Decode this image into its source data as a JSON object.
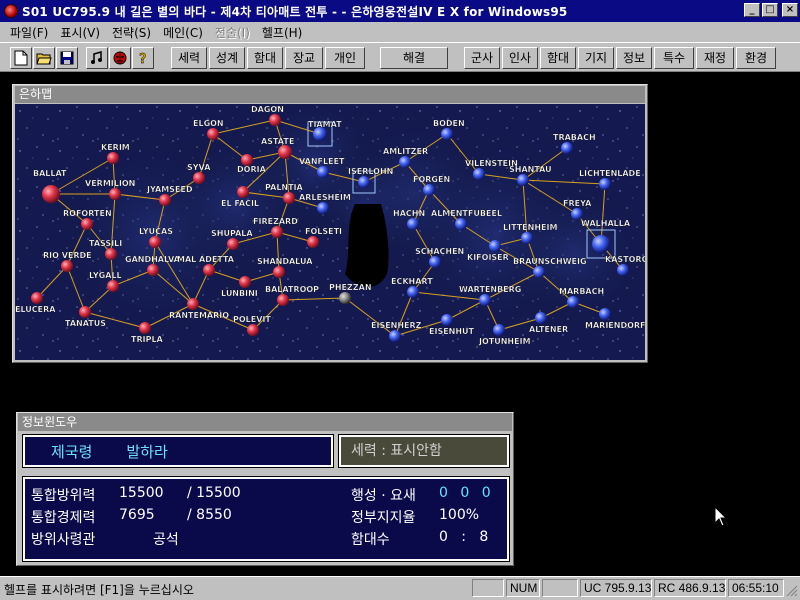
{
  "window": {
    "title": "S01 UC795.9  내 길은 별의 바다    - 제4차 티아매트 전투 - - 은하영웅전설IV  E X for Windows95",
    "min_label": "_",
    "max_label": "□",
    "close_label": "×"
  },
  "menu": [
    {
      "label": "파일(F)",
      "enabled": true
    },
    {
      "label": "표시(V)",
      "enabled": true
    },
    {
      "label": "전략(S)",
      "enabled": true
    },
    {
      "label": "메인(C)",
      "enabled": true
    },
    {
      "label": "전술(I)",
      "enabled": false
    },
    {
      "label": "헬프(H)",
      "enabled": true
    }
  ],
  "toolbar": {
    "icons": [
      "new-file-icon",
      "open-folder-icon",
      "save-disk-icon",
      "music-note-icon",
      "ladybug-icon",
      "help-question-icon"
    ],
    "groups": [
      [
        "세력",
        "성계",
        "함대",
        "장교",
        "개인"
      ],
      [
        "해결"
      ],
      [
        "군사",
        "인사",
        "함대",
        "기지",
        "정보",
        "특수",
        "재정",
        "환경"
      ]
    ]
  },
  "galaxy_map": {
    "caption": "은하맵",
    "empire_color": "#d8304a",
    "alliance_color": "#3c58e8",
    "neutral_color": "#8a8a8a",
    "link_color": "#d8a020",
    "systems": [
      {
        "name": "TIAMAT",
        "side": "alliance",
        "highlight": true
      },
      {
        "name": "DAGON",
        "side": "empire"
      },
      {
        "name": "ELGON",
        "side": "empire"
      },
      {
        "name": "KERIM",
        "side": "empire"
      },
      {
        "name": "ASTATE",
        "side": "empire"
      },
      {
        "name": "DORIA",
        "side": "empire"
      },
      {
        "name": "SYVA",
        "side": "empire"
      },
      {
        "name": "VANFLEET",
        "side": "alliance"
      },
      {
        "name": "ISERLOHN",
        "side": "alliance",
        "highlight": true
      },
      {
        "name": "BALLAT",
        "side": "empire"
      },
      {
        "name": "VERMILION",
        "side": "empire"
      },
      {
        "name": "JYAMSEED",
        "side": "empire"
      },
      {
        "name": "EL FACIL",
        "side": "empire"
      },
      {
        "name": "PALNTIA",
        "side": "empire"
      },
      {
        "name": "ARLESHEIM",
        "side": "alliance"
      },
      {
        "name": "ROFORTEN",
        "side": "empire"
      },
      {
        "name": "FIREZARD",
        "side": "empire"
      },
      {
        "name": "LYUCAS",
        "side": "empire"
      },
      {
        "name": "SHUPALA",
        "side": "empire"
      },
      {
        "name": "FOLSETI",
        "side": "empire"
      },
      {
        "name": "TASSILI",
        "side": "empire"
      },
      {
        "name": "RIO VERDE",
        "side": "empire"
      },
      {
        "name": "GANDHALVA",
        "side": "empire"
      },
      {
        "name": "MAL ADETTA",
        "side": "empire"
      },
      {
        "name": "SHANDALUA",
        "side": "empire"
      },
      {
        "name": "LYGALL",
        "side": "empire"
      },
      {
        "name": "LUNBINI",
        "side": "empire"
      },
      {
        "name": "PHEZZAN",
        "side": "neutral"
      },
      {
        "name": "BALATROOP",
        "side": "empire"
      },
      {
        "name": "ELUCERA",
        "side": "empire"
      },
      {
        "name": "RANTEMARIO",
        "side": "empire"
      },
      {
        "name": "TANATUS",
        "side": "empire"
      },
      {
        "name": "TRIPLA",
        "side": "empire"
      },
      {
        "name": "POLEVIT",
        "side": "empire"
      },
      {
        "name": "AMLITZER",
        "side": "alliance"
      },
      {
        "name": "BODEN",
        "side": "alliance"
      },
      {
        "name": "TRABACH",
        "side": "alliance"
      },
      {
        "name": "VILENSTEIN",
        "side": "alliance"
      },
      {
        "name": "SHANTAU",
        "side": "alliance"
      },
      {
        "name": "LICHTENLADE",
        "side": "alliance"
      },
      {
        "name": "FORGEN",
        "side": "alliance"
      },
      {
        "name": "FREYA",
        "side": "alliance"
      },
      {
        "name": "HACHN",
        "side": "alliance"
      },
      {
        "name": "ALMENTFUBEEL",
        "side": "alliance"
      },
      {
        "name": "LITTENHEIM",
        "side": "alliance"
      },
      {
        "name": "WALHALLA",
        "side": "alliance",
        "highlight": true
      },
      {
        "name": "SCHACHEN",
        "side": "alliance"
      },
      {
        "name": "KIFOISER",
        "side": "alliance"
      },
      {
        "name": "BRAUNSCHWEIG",
        "side": "alliance"
      },
      {
        "name": "KASTOROP",
        "side": "alliance"
      },
      {
        "name": "ECKHART",
        "side": "alliance"
      },
      {
        "name": "WARTENBERG",
        "side": "alliance"
      },
      {
        "name": "MARBACH",
        "side": "alliance"
      },
      {
        "name": "EISENHERZ",
        "side": "alliance"
      },
      {
        "name": "EISENHUT",
        "side": "alliance"
      },
      {
        "name": "JOTUNHEIM",
        "side": "alliance"
      },
      {
        "name": "ALTENER",
        "side": "alliance"
      },
      {
        "name": "MARIENDORF",
        "side": "alliance"
      }
    ]
  },
  "info_window": {
    "caption": "정보윈도우",
    "empire": {
      "part1": "제국령",
      "part2": "발하라"
    },
    "power_label": "세력 : 표시안함",
    "stats": {
      "defense_label": "통합방위력",
      "defense_value": "15500",
      "defense_max": "/ 15500",
      "economy_label": "통합경제력",
      "economy_value": "7695",
      "economy_max": "/ 8550",
      "commander_label": "방위사령관",
      "commander_value": "공석",
      "planet_label": "행성 · 요새",
      "planet_value": "0 0 0",
      "support_label": "정부지지율",
      "support_value": "100%",
      "fleets_label": "함대수",
      "fleets_value": "0   :   8"
    }
  },
  "statusbar": {
    "help": "헬프를 표시하려면 [F1]을 누르십시오",
    "num": "NUM",
    "uc_date": "UC 795.9.13",
    "rc_date": "RC 486.9.13",
    "time": "06:55:10"
  }
}
